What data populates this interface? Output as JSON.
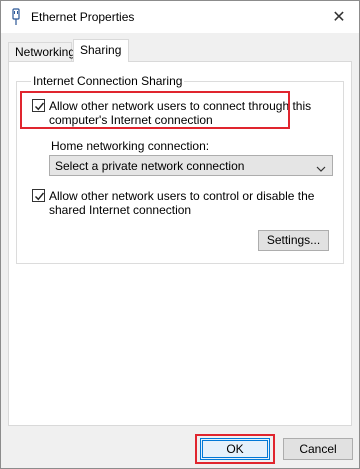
{
  "window": {
    "title": "Ethernet Properties",
    "close_glyph": "✕"
  },
  "tabs": [
    {
      "label": "Networking",
      "selected": false
    },
    {
      "label": "Sharing",
      "selected": true
    }
  ],
  "sharing": {
    "group_label": "Internet Connection Sharing",
    "allow_connect": {
      "checked": true,
      "label_line1": "Allow other network users to connect through this",
      "label_line2": "computer's Internet connection"
    },
    "home_networking_label": "Home networking connection:",
    "home_networking_select": {
      "value": "Select a private network connection"
    },
    "allow_control": {
      "checked": true,
      "label_line1": "Allow other network users to control or disable the",
      "label_line2": "shared Internet connection"
    },
    "settings_button": "Settings..."
  },
  "footer": {
    "ok_label": "OK",
    "cancel_label": "Cancel"
  },
  "colors": {
    "highlight": "#e0252e",
    "accent": "#0078d7"
  }
}
